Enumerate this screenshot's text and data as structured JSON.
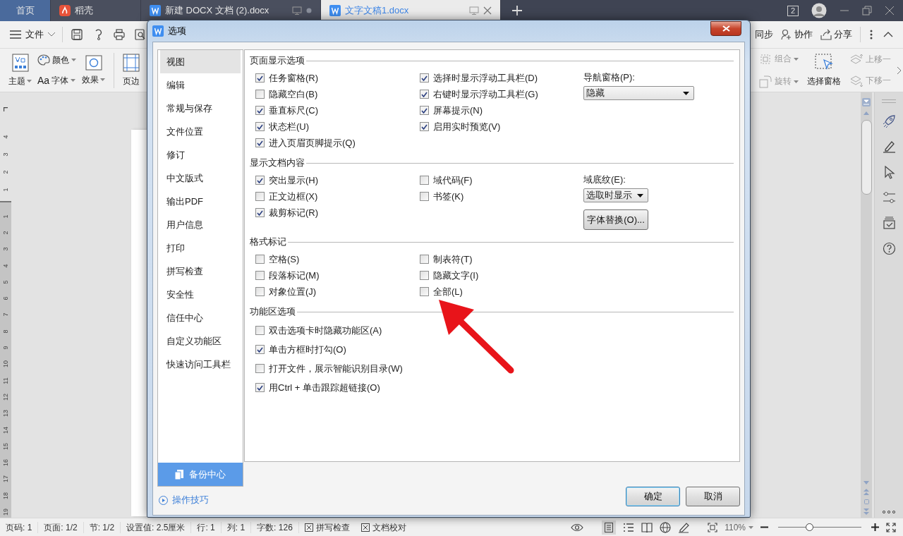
{
  "tabs": [
    {
      "label": "首页",
      "kind": "home",
      "selected": false
    },
    {
      "label": "稻壳",
      "kind": "docer",
      "selected": false
    },
    {
      "label": "新建 DOCX 文档 (2).docx",
      "kind": "doc",
      "selected": false
    },
    {
      "label": "文字文稿1.docx",
      "kind": "doc",
      "selected": true
    }
  ],
  "window_count": "2",
  "toolbar": {
    "menu": "文件",
    "right": [
      {
        "kind": "sync",
        "label": "同步"
      },
      {
        "kind": "collab",
        "label": "协作"
      },
      {
        "kind": "share",
        "label": "分享"
      }
    ]
  },
  "ribbon": {
    "left": [
      {
        "kind": "theme",
        "label": "主题"
      },
      {
        "kind": "colors",
        "label": "颜色"
      },
      {
        "kind": "font",
        "glyph": "Aa",
        "label": "字体"
      },
      {
        "kind": "effects",
        "label": "效果"
      },
      {
        "kind": "margins",
        "label": "页边"
      }
    ],
    "right": [
      {
        "kind": "group",
        "label": "组合",
        "disabled": true
      },
      {
        "kind": "rotate",
        "label": "旋转",
        "disabled": true
      },
      {
        "kind": "select-pane",
        "label": "选择窗格",
        "disabled": false
      },
      {
        "kind": "up",
        "label": "上移一",
        "disabled": true
      },
      {
        "kind": "down",
        "label": "下移一",
        "disabled": true
      }
    ]
  },
  "ruler": {
    "above": [
      "4",
      "3",
      "2",
      "1"
    ],
    "below": [
      "1",
      "2",
      "3",
      "4",
      "5",
      "6",
      "7",
      "8",
      "9",
      "10",
      "11",
      "12",
      "13",
      "14",
      "15",
      "16",
      "17",
      "18",
      "19"
    ]
  },
  "dialog": {
    "title": "选项",
    "sidebar": [
      {
        "label": "视图",
        "selected": true
      },
      {
        "label": "编辑",
        "selected": false
      },
      {
        "label": "常规与保存",
        "selected": false
      },
      {
        "label": "文件位置",
        "selected": false
      },
      {
        "label": "修订",
        "selected": false
      },
      {
        "label": "中文版式",
        "selected": false
      },
      {
        "label": "输出PDF",
        "selected": false
      },
      {
        "label": "用户信息",
        "selected": false
      },
      {
        "label": "打印",
        "selected": false
      },
      {
        "label": "拼写检查",
        "selected": false
      },
      {
        "label": "安全性",
        "selected": false
      },
      {
        "label": "信任中心",
        "selected": false
      },
      {
        "label": "自定义功能区",
        "selected": false
      },
      {
        "label": "快速访问工具栏",
        "selected": false
      }
    ],
    "backup": "备份中心",
    "tips": "操作技巧",
    "sections": [
      {
        "title": "页面显示选项",
        "columns": [
          [
            {
              "label": "任务窗格(R)",
              "checked": true
            },
            {
              "label": "隐藏空白(B)",
              "checked": false
            },
            {
              "label": "垂直标尺(C)",
              "checked": true
            },
            {
              "label": "状态栏(U)",
              "checked": true
            },
            {
              "label": "进入页眉页脚提示(Q)",
              "checked": true
            }
          ],
          [
            {
              "label": "选择时显示浮动工具栏(D)",
              "checked": true
            },
            {
              "label": "右键时显示浮动工具栏(G)",
              "checked": true
            },
            {
              "label": "屏幕提示(N)",
              "checked": true
            },
            {
              "label": "启用实时预览(V)",
              "checked": true
            }
          ]
        ],
        "side": [
          {
            "kind": "dropdown",
            "label": "导航窗格(P):",
            "value": "隐藏"
          }
        ]
      },
      {
        "title": "显示文档内容",
        "columns": [
          [
            {
              "label": "突出显示(H)",
              "checked": true
            },
            {
              "label": "正文边框(X)",
              "checked": false
            },
            {
              "label": "裁剪标记(R)",
              "checked": true
            }
          ],
          [
            {
              "label": "域代码(F)",
              "checked": false
            },
            {
              "label": "书签(K)",
              "checked": false
            }
          ]
        ],
        "side": [
          {
            "kind": "dropdown",
            "label": "域底纹(E):",
            "value": "选取时显示"
          },
          {
            "kind": "button",
            "label": "字体替换(O)..."
          }
        ]
      },
      {
        "title": "格式标记",
        "columns": [
          [
            {
              "label": "空格(S)",
              "checked": false
            },
            {
              "label": "段落标记(M)",
              "checked": false
            },
            {
              "label": "对象位置(J)",
              "checked": false
            }
          ],
          [
            {
              "label": "制表符(T)",
              "checked": false
            },
            {
              "label": "隐藏文字(I)",
              "checked": false
            },
            {
              "label": "全部(L)",
              "checked": false
            }
          ]
        ]
      },
      {
        "title": "功能区选项",
        "columns": [
          [
            {
              "label": "双击选项卡时隐藏功能区(A)",
              "checked": false
            },
            {
              "label": "单击方框时打勾(O)",
              "checked": true
            },
            {
              "label": "打开文件，展示智能识别目录(W)",
              "checked": false
            },
            {
              "label": "用Ctrl + 单击跟踪超链接(O)",
              "checked": true
            }
          ]
        ]
      }
    ],
    "buttons": [
      {
        "label": "确定",
        "default": true
      },
      {
        "label": "取消",
        "default": false
      }
    ]
  },
  "annotation": {
    "kind": "arrow"
  },
  "status_bar": {
    "items": [
      {
        "kind": "text",
        "label": "页码: 1"
      },
      {
        "kind": "text",
        "label": "页面: 1/2"
      },
      {
        "kind": "text",
        "label": "节: 1/2"
      },
      {
        "kind": "text",
        "label": "设置值: 2.5厘米"
      },
      {
        "kind": "text",
        "label": "行: 1"
      },
      {
        "kind": "text",
        "label": "列: 1"
      },
      {
        "kind": "text",
        "label": "字数: 126"
      },
      {
        "kind": "check",
        "label": "拼写检查"
      },
      {
        "kind": "check",
        "label": "文档校对"
      }
    ],
    "zoom": "110%",
    "zoom_slider": {
      "level": 0.37
    }
  }
}
